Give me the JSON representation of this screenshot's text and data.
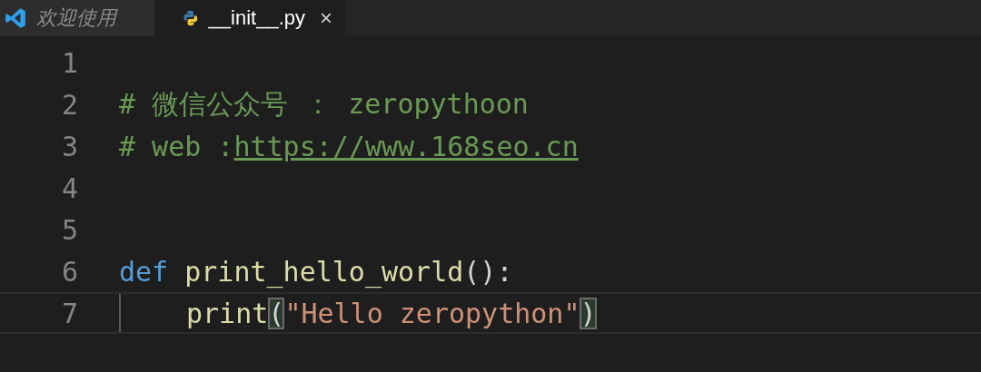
{
  "tabs": [
    {
      "label": "欢迎使用",
      "kind": "welcome",
      "selected": false,
      "preview": true
    },
    {
      "label": "__init__.py",
      "kind": "file",
      "selected": true,
      "preview": false,
      "close": "×"
    }
  ],
  "editor": {
    "lines": [
      {
        "number": "1",
        "current": false,
        "indent": false
      },
      {
        "number": "2",
        "current": false,
        "indent": false,
        "tokens": [
          {
            "kind": "comment",
            "text": "# 微信公众号 ： zeropythoon"
          }
        ]
      },
      {
        "number": "3",
        "current": false,
        "indent": false,
        "tokens": [
          {
            "kind": "comment",
            "text": "# web :"
          },
          {
            "kind": "link",
            "text": "https://www.168seo.cn"
          }
        ]
      },
      {
        "number": "4",
        "current": false,
        "indent": false
      },
      {
        "number": "5",
        "current": false,
        "indent": false
      },
      {
        "number": "6",
        "current": false,
        "indent": false,
        "tokens": [
          {
            "kind": "keyword",
            "text": "def "
          },
          {
            "kind": "function",
            "text": "print_hello_world"
          },
          {
            "kind": "punct",
            "text": "()"
          },
          {
            "kind": "plain",
            "text": ":"
          }
        ]
      },
      {
        "number": "7",
        "current": true,
        "indent": true,
        "tokens": [
          {
            "kind": "function",
            "text": "print"
          },
          {
            "kind": "punct",
            "text": "(",
            "matched": true
          },
          {
            "kind": "string",
            "text": "\"Hello zeropython\""
          },
          {
            "kind": "punct",
            "text": ")",
            "matched": true
          }
        ]
      }
    ]
  }
}
